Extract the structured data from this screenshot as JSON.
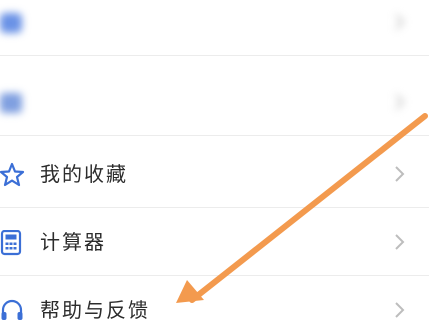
{
  "menu": {
    "items": [
      {
        "label": "",
        "icon": "blurred-icon",
        "blurred": true
      },
      {
        "label": "",
        "icon": "blurred-icon",
        "blurred": true
      },
      {
        "label": "我的收藏",
        "icon": "star-icon"
      },
      {
        "label": "计算器",
        "icon": "calculator-icon"
      },
      {
        "label": "帮助与反馈",
        "icon": "headset-icon"
      }
    ]
  },
  "colors": {
    "icon_blue": "#3b6fd6",
    "arrow_orange": "#f39a4e",
    "chevron_gray": "#bdbdbd",
    "divider": "#ececec"
  }
}
